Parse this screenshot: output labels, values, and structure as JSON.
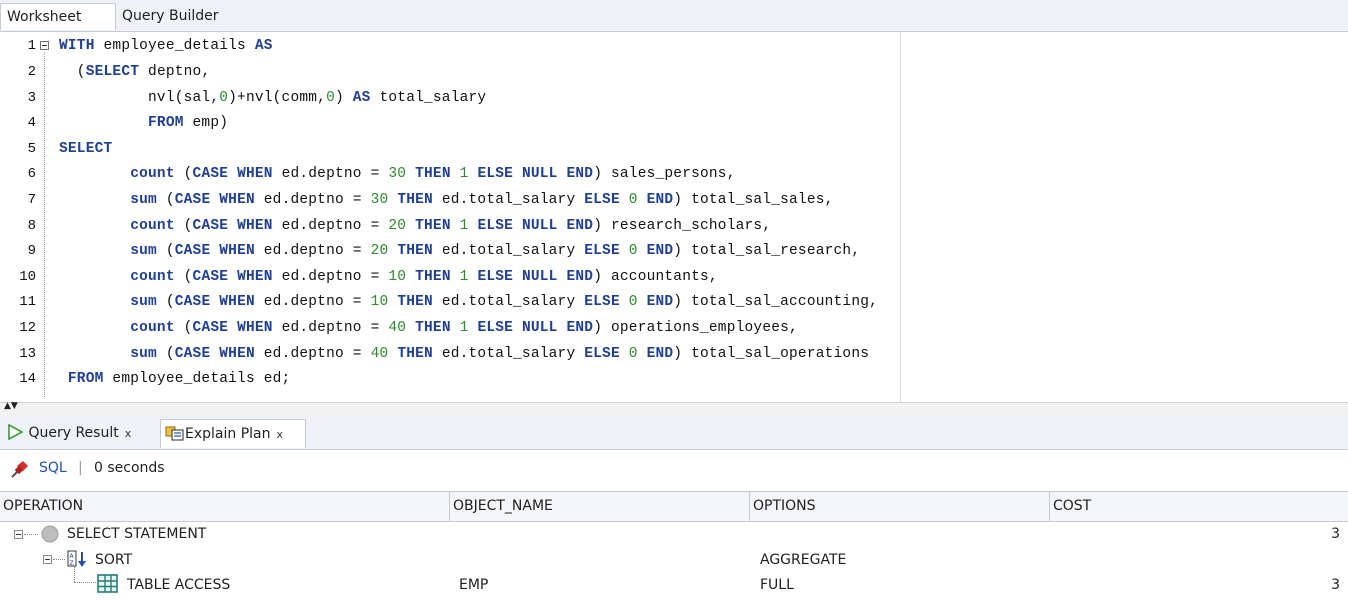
{
  "tabs": [
    {
      "label": "Worksheet",
      "active": true
    },
    {
      "label": "Query Builder",
      "active": false
    }
  ],
  "code_lines": [
    {
      "n": "1",
      "tokens": [
        {
          "t": "WITH",
          "k": "kw"
        },
        {
          "t": " employee_details ",
          "k": ""
        },
        {
          "t": "AS",
          "k": "kw"
        }
      ]
    },
    {
      "n": "2",
      "tokens": [
        {
          "t": "  (",
          "k": ""
        },
        {
          "t": "SELECT",
          "k": "kw"
        },
        {
          "t": " deptno,",
          "k": ""
        }
      ]
    },
    {
      "n": "3",
      "tokens": [
        {
          "t": "          nvl(sal,",
          "k": ""
        },
        {
          "t": "0",
          "k": "num"
        },
        {
          "t": ")+nvl(comm,",
          "k": ""
        },
        {
          "t": "0",
          "k": "num"
        },
        {
          "t": ") ",
          "k": ""
        },
        {
          "t": "AS",
          "k": "kw"
        },
        {
          "t": " total_salary",
          "k": ""
        }
      ]
    },
    {
      "n": "4",
      "tokens": [
        {
          "t": "          ",
          "k": ""
        },
        {
          "t": "FROM",
          "k": "kw"
        },
        {
          "t": " emp)",
          "k": ""
        }
      ]
    },
    {
      "n": "5",
      "tokens": [
        {
          "t": "SELECT",
          "k": "kw"
        }
      ]
    },
    {
      "n": "6",
      "tokens": [
        {
          "t": "        ",
          "k": ""
        },
        {
          "t": "count",
          "k": "kw"
        },
        {
          "t": " (",
          "k": ""
        },
        {
          "t": "CASE",
          "k": "kw"
        },
        {
          "t": " ",
          "k": ""
        },
        {
          "t": "WHEN",
          "k": "kw"
        },
        {
          "t": " ed.deptno = ",
          "k": ""
        },
        {
          "t": "30",
          "k": "num"
        },
        {
          "t": " ",
          "k": ""
        },
        {
          "t": "THEN",
          "k": "kw"
        },
        {
          "t": " ",
          "k": ""
        },
        {
          "t": "1",
          "k": "num"
        },
        {
          "t": " ",
          "k": ""
        },
        {
          "t": "ELSE",
          "k": "kw"
        },
        {
          "t": " ",
          "k": ""
        },
        {
          "t": "NULL",
          "k": "kw"
        },
        {
          "t": " ",
          "k": ""
        },
        {
          "t": "END",
          "k": "kw"
        },
        {
          "t": ") sales_persons,",
          "k": ""
        }
      ]
    },
    {
      "n": "7",
      "tokens": [
        {
          "t": "        ",
          "k": ""
        },
        {
          "t": "sum",
          "k": "kw"
        },
        {
          "t": " (",
          "k": ""
        },
        {
          "t": "CASE",
          "k": "kw"
        },
        {
          "t": " ",
          "k": ""
        },
        {
          "t": "WHEN",
          "k": "kw"
        },
        {
          "t": " ed.deptno = ",
          "k": ""
        },
        {
          "t": "30",
          "k": "num"
        },
        {
          "t": " ",
          "k": ""
        },
        {
          "t": "THEN",
          "k": "kw"
        },
        {
          "t": " ed.total_salary ",
          "k": ""
        },
        {
          "t": "ELSE",
          "k": "kw"
        },
        {
          "t": " ",
          "k": ""
        },
        {
          "t": "0",
          "k": "num"
        },
        {
          "t": " ",
          "k": ""
        },
        {
          "t": "END",
          "k": "kw"
        },
        {
          "t": ") total_sal_sales,",
          "k": ""
        }
      ]
    },
    {
      "n": "8",
      "tokens": [
        {
          "t": "        ",
          "k": ""
        },
        {
          "t": "count",
          "k": "kw"
        },
        {
          "t": " (",
          "k": ""
        },
        {
          "t": "CASE",
          "k": "kw"
        },
        {
          "t": " ",
          "k": ""
        },
        {
          "t": "WHEN",
          "k": "kw"
        },
        {
          "t": " ed.deptno = ",
          "k": ""
        },
        {
          "t": "20",
          "k": "num"
        },
        {
          "t": " ",
          "k": ""
        },
        {
          "t": "THEN",
          "k": "kw"
        },
        {
          "t": " ",
          "k": ""
        },
        {
          "t": "1",
          "k": "num"
        },
        {
          "t": " ",
          "k": ""
        },
        {
          "t": "ELSE",
          "k": "kw"
        },
        {
          "t": " ",
          "k": ""
        },
        {
          "t": "NULL",
          "k": "kw"
        },
        {
          "t": " ",
          "k": ""
        },
        {
          "t": "END",
          "k": "kw"
        },
        {
          "t": ") research_scholars,",
          "k": ""
        }
      ]
    },
    {
      "n": "9",
      "tokens": [
        {
          "t": "        ",
          "k": ""
        },
        {
          "t": "sum",
          "k": "kw"
        },
        {
          "t": " (",
          "k": ""
        },
        {
          "t": "CASE",
          "k": "kw"
        },
        {
          "t": " ",
          "k": ""
        },
        {
          "t": "WHEN",
          "k": "kw"
        },
        {
          "t": " ed.deptno = ",
          "k": ""
        },
        {
          "t": "20",
          "k": "num"
        },
        {
          "t": " ",
          "k": ""
        },
        {
          "t": "THEN",
          "k": "kw"
        },
        {
          "t": " ed.total_salary ",
          "k": ""
        },
        {
          "t": "ELSE",
          "k": "kw"
        },
        {
          "t": " ",
          "k": ""
        },
        {
          "t": "0",
          "k": "num"
        },
        {
          "t": " ",
          "k": ""
        },
        {
          "t": "END",
          "k": "kw"
        },
        {
          "t": ") total_sal_research,",
          "k": ""
        }
      ]
    },
    {
      "n": "10",
      "tokens": [
        {
          "t": "        ",
          "k": ""
        },
        {
          "t": "count",
          "k": "kw"
        },
        {
          "t": " (",
          "k": ""
        },
        {
          "t": "CASE",
          "k": "kw"
        },
        {
          "t": " ",
          "k": ""
        },
        {
          "t": "WHEN",
          "k": "kw"
        },
        {
          "t": " ed.deptno = ",
          "k": ""
        },
        {
          "t": "10",
          "k": "num"
        },
        {
          "t": " ",
          "k": ""
        },
        {
          "t": "THEN",
          "k": "kw"
        },
        {
          "t": " ",
          "k": ""
        },
        {
          "t": "1",
          "k": "num"
        },
        {
          "t": " ",
          "k": ""
        },
        {
          "t": "ELSE",
          "k": "kw"
        },
        {
          "t": " ",
          "k": ""
        },
        {
          "t": "NULL",
          "k": "kw"
        },
        {
          "t": " ",
          "k": ""
        },
        {
          "t": "END",
          "k": "kw"
        },
        {
          "t": ") accountants,",
          "k": ""
        }
      ]
    },
    {
      "n": "11",
      "tokens": [
        {
          "t": "        ",
          "k": ""
        },
        {
          "t": "sum",
          "k": "kw"
        },
        {
          "t": " (",
          "k": ""
        },
        {
          "t": "CASE",
          "k": "kw"
        },
        {
          "t": " ",
          "k": ""
        },
        {
          "t": "WHEN",
          "k": "kw"
        },
        {
          "t": " ed.deptno = ",
          "k": ""
        },
        {
          "t": "10",
          "k": "num"
        },
        {
          "t": " ",
          "k": ""
        },
        {
          "t": "THEN",
          "k": "kw"
        },
        {
          "t": " ed.total_salary ",
          "k": ""
        },
        {
          "t": "ELSE",
          "k": "kw"
        },
        {
          "t": " ",
          "k": ""
        },
        {
          "t": "0",
          "k": "num"
        },
        {
          "t": " ",
          "k": ""
        },
        {
          "t": "END",
          "k": "kw"
        },
        {
          "t": ") total_sal_accounting,",
          "k": ""
        }
      ]
    },
    {
      "n": "12",
      "tokens": [
        {
          "t": "        ",
          "k": ""
        },
        {
          "t": "count",
          "k": "kw"
        },
        {
          "t": " (",
          "k": ""
        },
        {
          "t": "CASE",
          "k": "kw"
        },
        {
          "t": " ",
          "k": ""
        },
        {
          "t": "WHEN",
          "k": "kw"
        },
        {
          "t": " ed.deptno = ",
          "k": ""
        },
        {
          "t": "40",
          "k": "num"
        },
        {
          "t": " ",
          "k": ""
        },
        {
          "t": "THEN",
          "k": "kw"
        },
        {
          "t": " ",
          "k": ""
        },
        {
          "t": "1",
          "k": "num"
        },
        {
          "t": " ",
          "k": ""
        },
        {
          "t": "ELSE",
          "k": "kw"
        },
        {
          "t": " ",
          "k": ""
        },
        {
          "t": "NULL",
          "k": "kw"
        },
        {
          "t": " ",
          "k": ""
        },
        {
          "t": "END",
          "k": "kw"
        },
        {
          "t": ") operations_employees,",
          "k": ""
        }
      ]
    },
    {
      "n": "13",
      "tokens": [
        {
          "t": "        ",
          "k": ""
        },
        {
          "t": "sum",
          "k": "kw"
        },
        {
          "t": " (",
          "k": ""
        },
        {
          "t": "CASE",
          "k": "kw"
        },
        {
          "t": " ",
          "k": ""
        },
        {
          "t": "WHEN",
          "k": "kw"
        },
        {
          "t": " ed.deptno = ",
          "k": ""
        },
        {
          "t": "40",
          "k": "num"
        },
        {
          "t": " ",
          "k": ""
        },
        {
          "t": "THEN",
          "k": "kw"
        },
        {
          "t": " ed.total_salary ",
          "k": ""
        },
        {
          "t": "ELSE",
          "k": "kw"
        },
        {
          "t": " ",
          "k": ""
        },
        {
          "t": "0",
          "k": "num"
        },
        {
          "t": " ",
          "k": ""
        },
        {
          "t": "END",
          "k": "kw"
        },
        {
          "t": ") total_sal_operations",
          "k": ""
        }
      ]
    },
    {
      "n": "14",
      "tokens": [
        {
          "t": " ",
          "k": ""
        },
        {
          "t": "FROM",
          "k": "kw"
        },
        {
          "t": " employee_details ed;",
          "k": ""
        }
      ]
    }
  ],
  "result_tabs": [
    {
      "label": "Query Result",
      "close": "x",
      "icon": "play-icon"
    },
    {
      "label": "Explain Plan",
      "close": "x",
      "icon": "explain-plan-icon",
      "active": true
    }
  ],
  "toolbar": {
    "sql_label": "SQL",
    "separator": "|",
    "time": "0 seconds"
  },
  "plan": {
    "columns": [
      "OPERATION",
      "OBJECT_NAME",
      "OPTIONS",
      "COST"
    ],
    "rows": [
      {
        "operation": "SELECT STATEMENT",
        "object_name": "",
        "options": "",
        "cost": "3",
        "icon": "select-statement-icon"
      },
      {
        "operation": "SORT",
        "object_name": "",
        "options": "AGGREGATE",
        "cost": "",
        "icon": "sort-icon"
      },
      {
        "operation": "TABLE ACCESS",
        "object_name": "EMP",
        "options": "FULL",
        "cost": "3",
        "icon": "table-icon"
      }
    ]
  },
  "colors": {
    "keyword": "#1f3f96",
    "number": "#2e8b2e",
    "pin": "#c62828",
    "link": "#1f4fb5"
  }
}
